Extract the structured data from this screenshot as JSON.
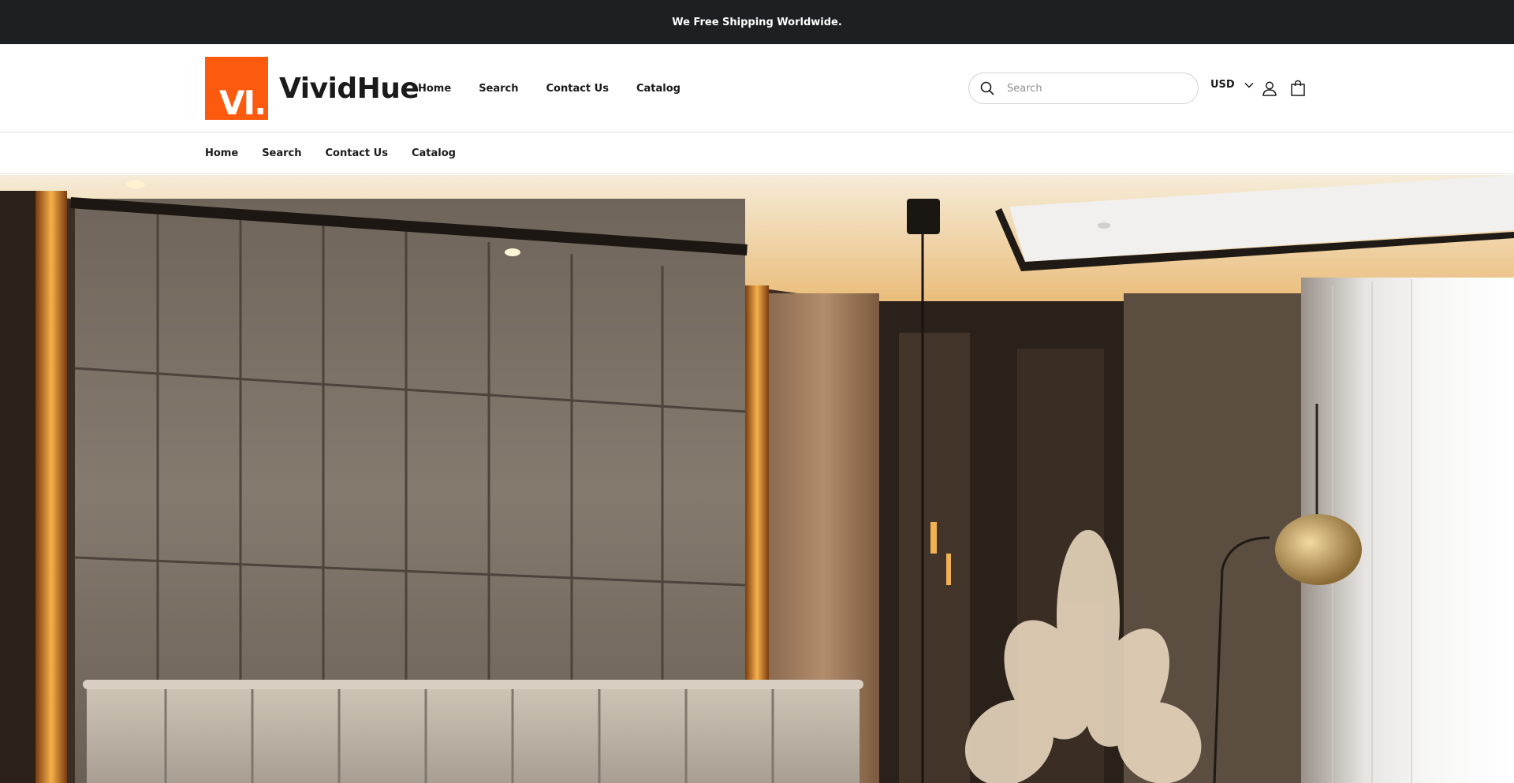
{
  "announcement": {
    "text": "We Free Shipping Worldwide."
  },
  "brand": {
    "logo_mark": "VI.",
    "name": "VividHue",
    "accent": "#fb5a0f"
  },
  "header": {
    "nav": [
      "Home",
      "Search",
      "Contact Us",
      "Catalog"
    ],
    "search": {
      "placeholder": "Search",
      "value": "",
      "icon": "search-icon"
    },
    "currency": {
      "selected": "USD",
      "icon": "chevron-down-icon"
    },
    "account_icon": "user-icon",
    "cart_icon": "shopping-bag-icon"
  },
  "sub_nav": [
    "Home",
    "Search",
    "Contact Us",
    "Catalog"
  ],
  "hero": {
    "image": "bedroom-interior-photo"
  }
}
